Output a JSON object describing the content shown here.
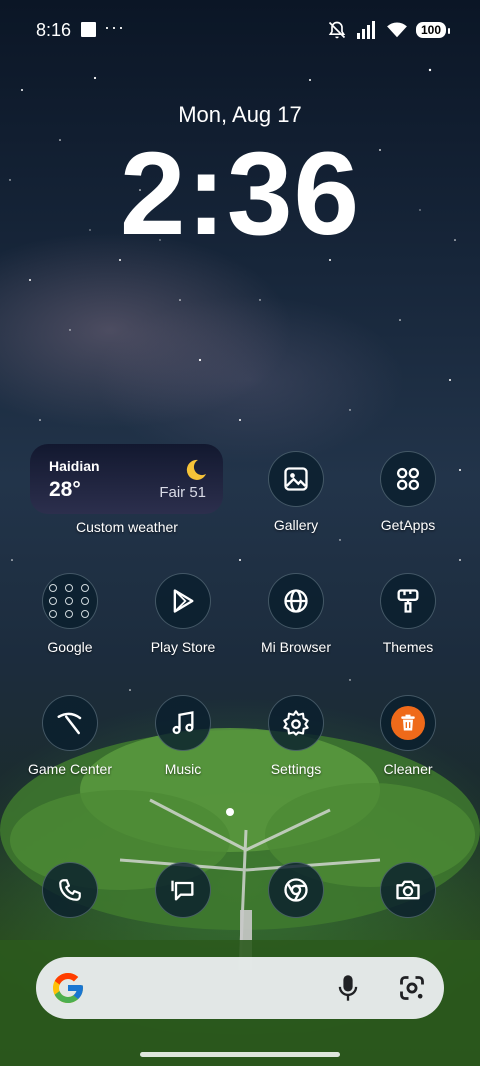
{
  "status_bar": {
    "time": "8:16",
    "more_indicator": "···",
    "battery": "100",
    "icons": [
      "notification-square-icon",
      "mute-icon",
      "signal-icon",
      "wifi-icon",
      "battery-icon"
    ]
  },
  "lockscreen": {
    "date": "Mon, Aug 17",
    "time": "2:36"
  },
  "weather": {
    "city": "Haidian",
    "temperature": "28°",
    "condition": "Fair 51",
    "icon": "moon-icon",
    "label": "Custom weather"
  },
  "apps": {
    "gallery": {
      "label": "Gallery",
      "icon": "gallery-icon"
    },
    "getapps": {
      "label": "GetApps",
      "icon": "getapps-icon"
    },
    "google": {
      "label": "Google",
      "icon": "folder-icon"
    },
    "play_store": {
      "label": "Play Store",
      "icon": "play-store-icon"
    },
    "mi_browser": {
      "label": "Mi Browser",
      "icon": "globe-icon"
    },
    "themes": {
      "label": "Themes",
      "icon": "paint-brush-icon"
    },
    "game_center": {
      "label": "Game Center",
      "icon": "game-center-icon"
    },
    "music": {
      "label": "Music",
      "icon": "music-note-icon"
    },
    "settings": {
      "label": "Settings",
      "icon": "gear-icon"
    },
    "cleaner": {
      "label": "Cleaner",
      "icon": "trash-icon"
    }
  },
  "dock": [
    "phone-icon",
    "messages-icon",
    "chrome-icon",
    "camera-icon"
  ],
  "search_bar": {
    "icons": [
      "google-g-icon",
      "microphone-icon",
      "lens-icon"
    ]
  },
  "colors": {
    "cleaner_accent": "#ef6a1a",
    "moon": "#f6c338",
    "search_bar_bg": "#eceff1"
  }
}
